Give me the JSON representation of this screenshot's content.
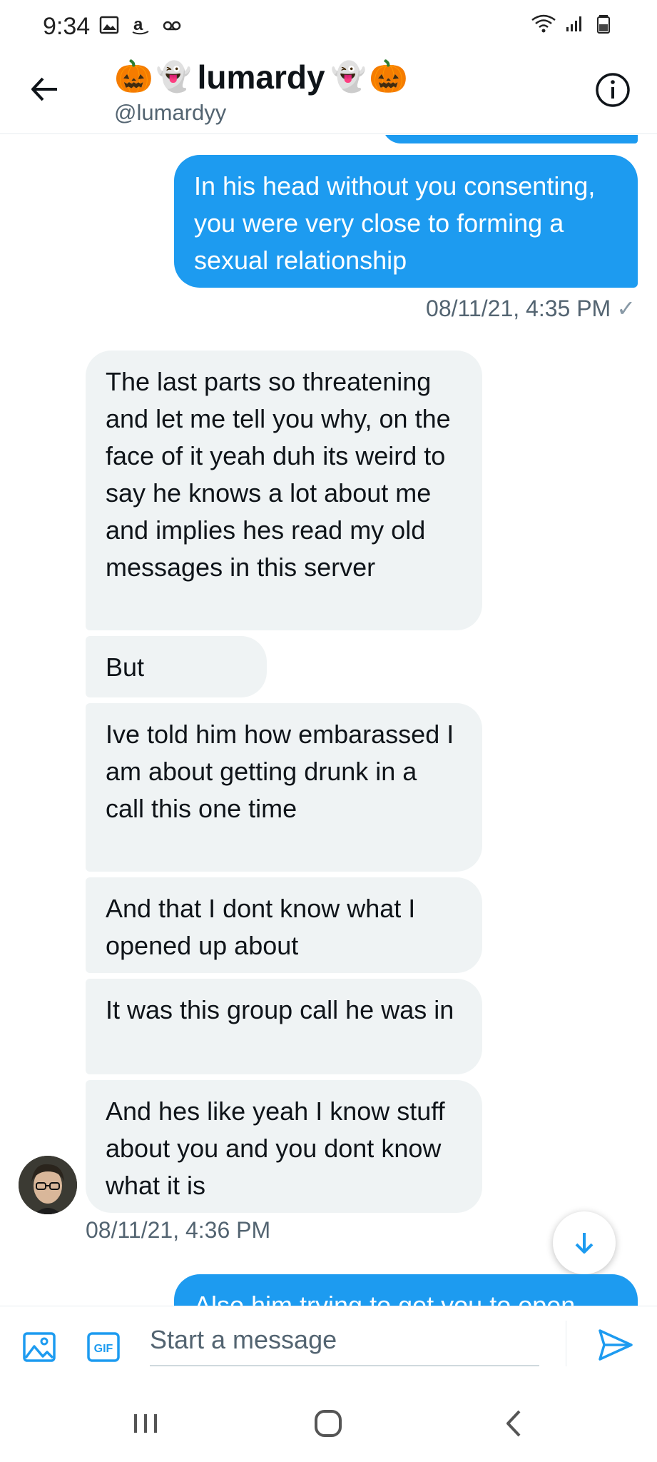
{
  "status_bar": {
    "time": "9:34",
    "icons_left": [
      "gallery-icon",
      "amazon-icon",
      "voicemail-icon"
    ],
    "icons_right": [
      "wifi-icon",
      "signal-icon",
      "battery-icon"
    ]
  },
  "header": {
    "back_icon": "arrow-left-icon",
    "display_name": "lumardy",
    "emoji_pumpkin": "🎃",
    "emoji_ghost": "👻",
    "handle": "@lumardyy",
    "info_icon": "info-icon"
  },
  "messages": [
    {
      "direction": "out",
      "text": "In his head without you consenting, you were very close to forming a sexual relationship"
    },
    {
      "direction": "in",
      "text": "The last parts so threatening and let me tell you why, on the face of it yeah duh its weird to say he knows a lot about me and implies hes read my old messages in this server"
    },
    {
      "direction": "in",
      "text": "But"
    },
    {
      "direction": "in",
      "text": "Ive told him how embarassed I am about getting drunk in a call this one time"
    },
    {
      "direction": "in",
      "text": "And that I dont know what I opened up about"
    },
    {
      "direction": "in",
      "text": "It was this group call he was in"
    },
    {
      "direction": "in",
      "text": "And hes like yeah I know stuff about you and you dont know what it is"
    },
    {
      "direction": "out",
      "text": "Also him trying to get you to open"
    }
  ],
  "timestamps": {
    "outgoing": "08/11/21, 4:35 PM",
    "outgoing_check": "✓",
    "incoming": "08/11/21, 4:36 PM"
  },
  "composer": {
    "placeholder": "Start a message",
    "media_icon": "image-icon",
    "gif_label": "GIF",
    "send_icon": "send-icon"
  },
  "nav_bar": {
    "items": [
      "recent-apps-icon",
      "home-icon",
      "back-icon"
    ]
  },
  "colors": {
    "accent": "#1d9bf0",
    "incoming_bubble": "#eff3f4",
    "secondary_text": "#536471"
  }
}
